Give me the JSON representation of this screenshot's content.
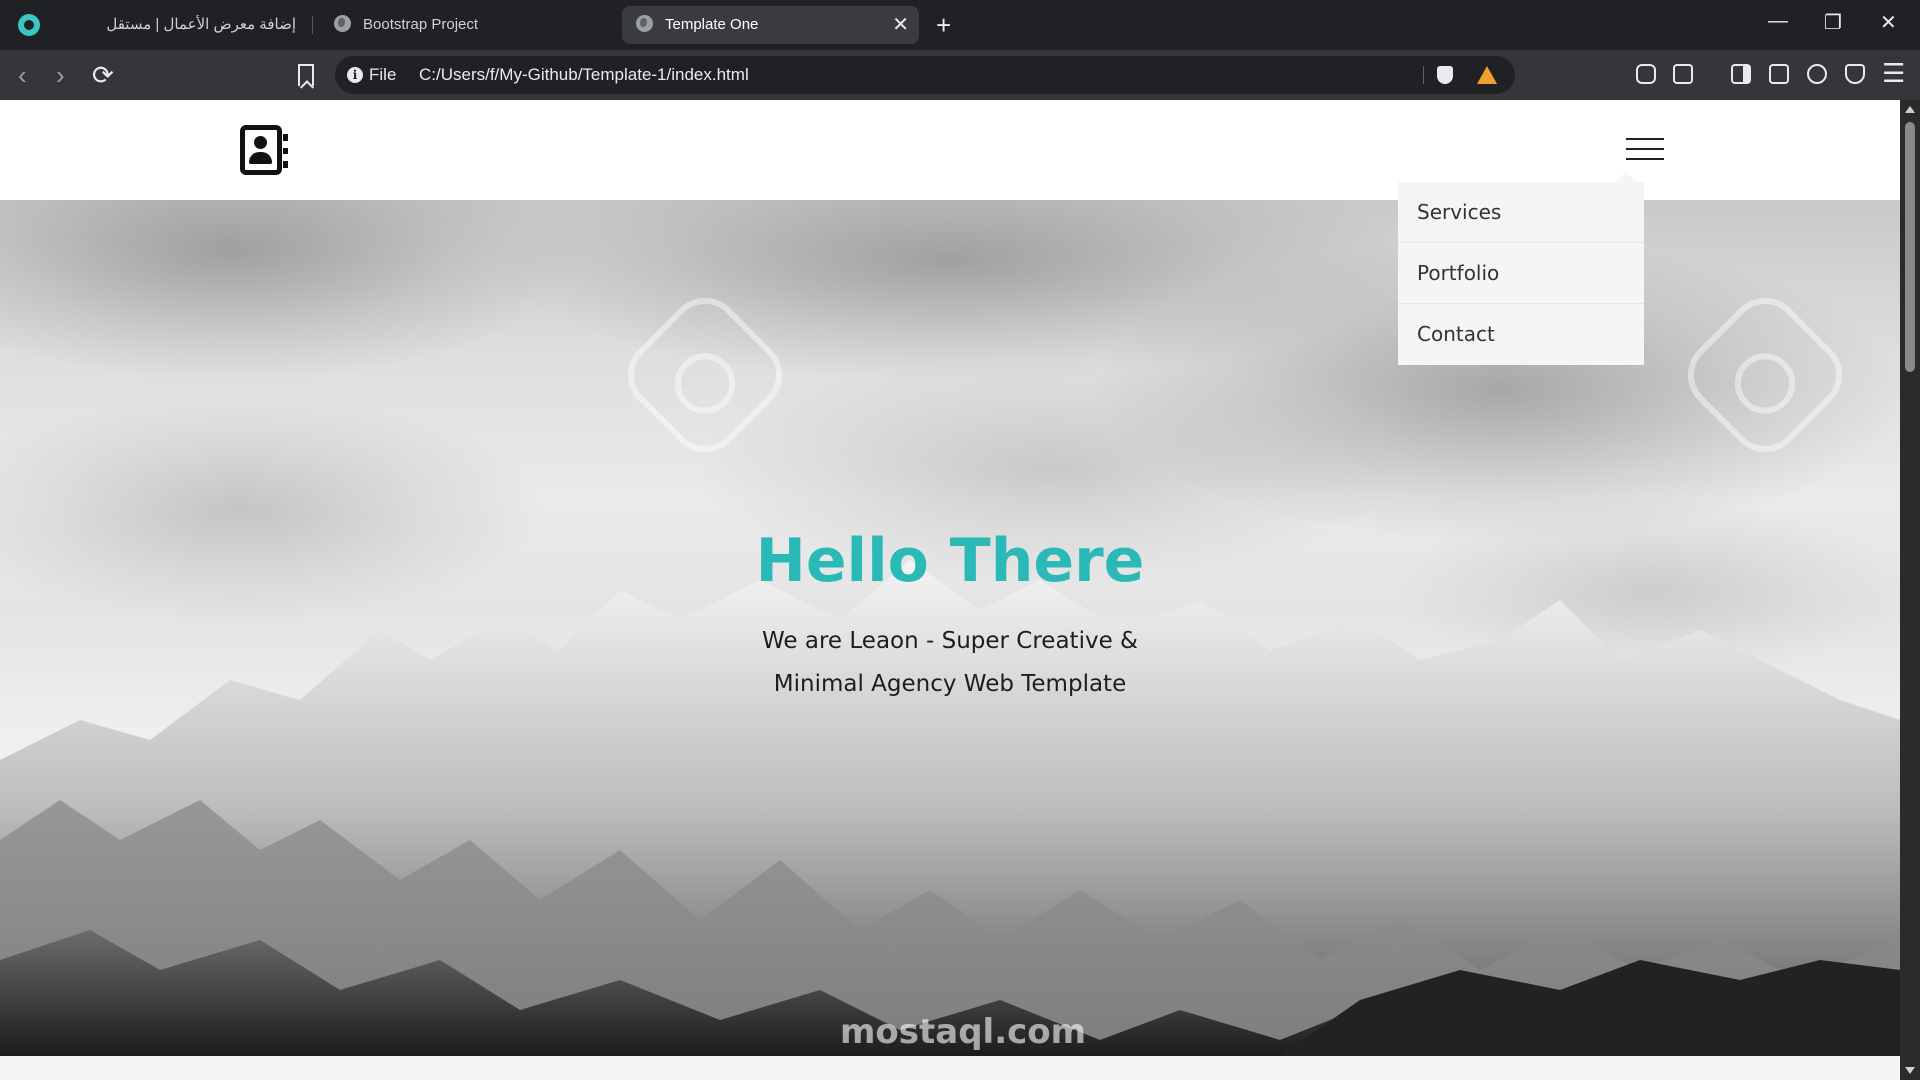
{
  "browser": {
    "tabs": [
      {
        "title": "إضافة معرض الأعمال | مستقل",
        "active": false
      },
      {
        "title": "Bootstrap Project",
        "active": false
      },
      {
        "title": "Template One",
        "active": true
      }
    ],
    "new_tab_label": "+",
    "close_tab_label": "✕",
    "window_controls": {
      "minimize": "—",
      "restore": "❐",
      "close": "✕"
    },
    "address": {
      "scheme": "File",
      "url": "C:/Users/f/My-Github/Template-1/index.html"
    }
  },
  "site": {
    "menu": {
      "items": [
        "Services",
        "Portfolio",
        "Contact"
      ]
    },
    "hero": {
      "title": "Hello There",
      "subtitle_line1": "We are Leaon - Super Creative &",
      "subtitle_line2": "Minimal Agency Web Template",
      "title_color": "#2bb9b8"
    },
    "watermark_text": "mostaql.com"
  }
}
